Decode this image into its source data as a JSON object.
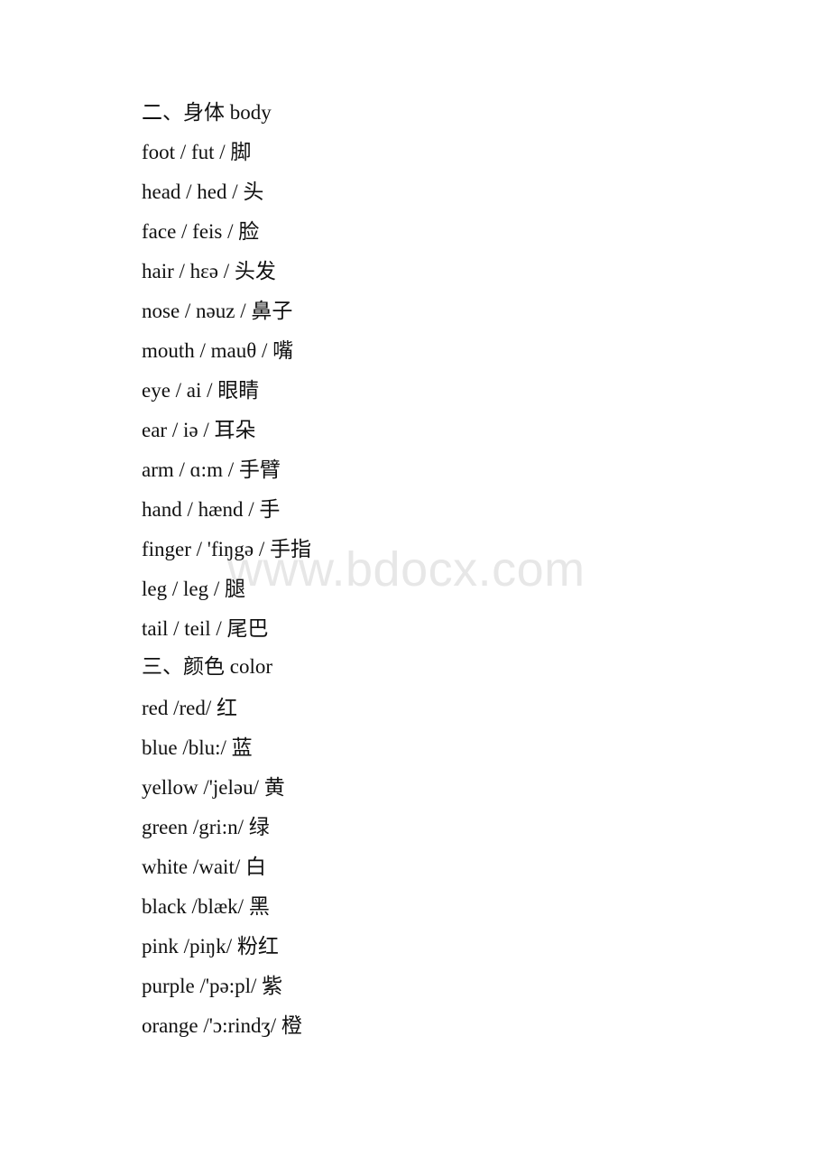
{
  "document": {
    "watermark": "www.bdocx.com",
    "watermark_color": "#e7e7e7",
    "text_color": "#111111",
    "background_color": "#ffffff"
  },
  "sections": [
    {
      "heading": "二、身体 body",
      "entries": [
        {
          "text": "foot / fut / 脚"
        },
        {
          "text": "head / hed / 头"
        },
        {
          "text": "face / feis / 脸"
        },
        {
          "text": "hair / hɛə / 头发"
        },
        {
          "text": "nose / nəuz / 鼻子"
        },
        {
          "text": "mouth / mauθ / 嘴"
        },
        {
          "text": "eye / ai / 眼睛"
        },
        {
          "text": "ear / iə / 耳朵"
        },
        {
          "text": "arm / ɑ:m / 手臂"
        },
        {
          "text": "hand / hænd / 手"
        },
        {
          "text": "finger / 'fiŋgə / 手指"
        },
        {
          "text": "leg / leg / 腿"
        },
        {
          "text": "tail / teil / 尾巴"
        }
      ]
    },
    {
      "heading": "三、颜色 color",
      "entries": [
        {
          "text": "red /red/ 红"
        },
        {
          "text": "blue /blu:/ 蓝"
        },
        {
          "text": "yellow /'jeləu/ 黄"
        },
        {
          "text": "green /gri:n/ 绿"
        },
        {
          "text": "white /wait/ 白"
        },
        {
          "text": "black /blæk/ 黑"
        },
        {
          "text": "pink /piŋk/ 粉红"
        },
        {
          "text": "purple /'pə:pl/ 紫"
        },
        {
          "text": "orange /'ɔ:rindʒ/ 橙"
        }
      ]
    }
  ]
}
